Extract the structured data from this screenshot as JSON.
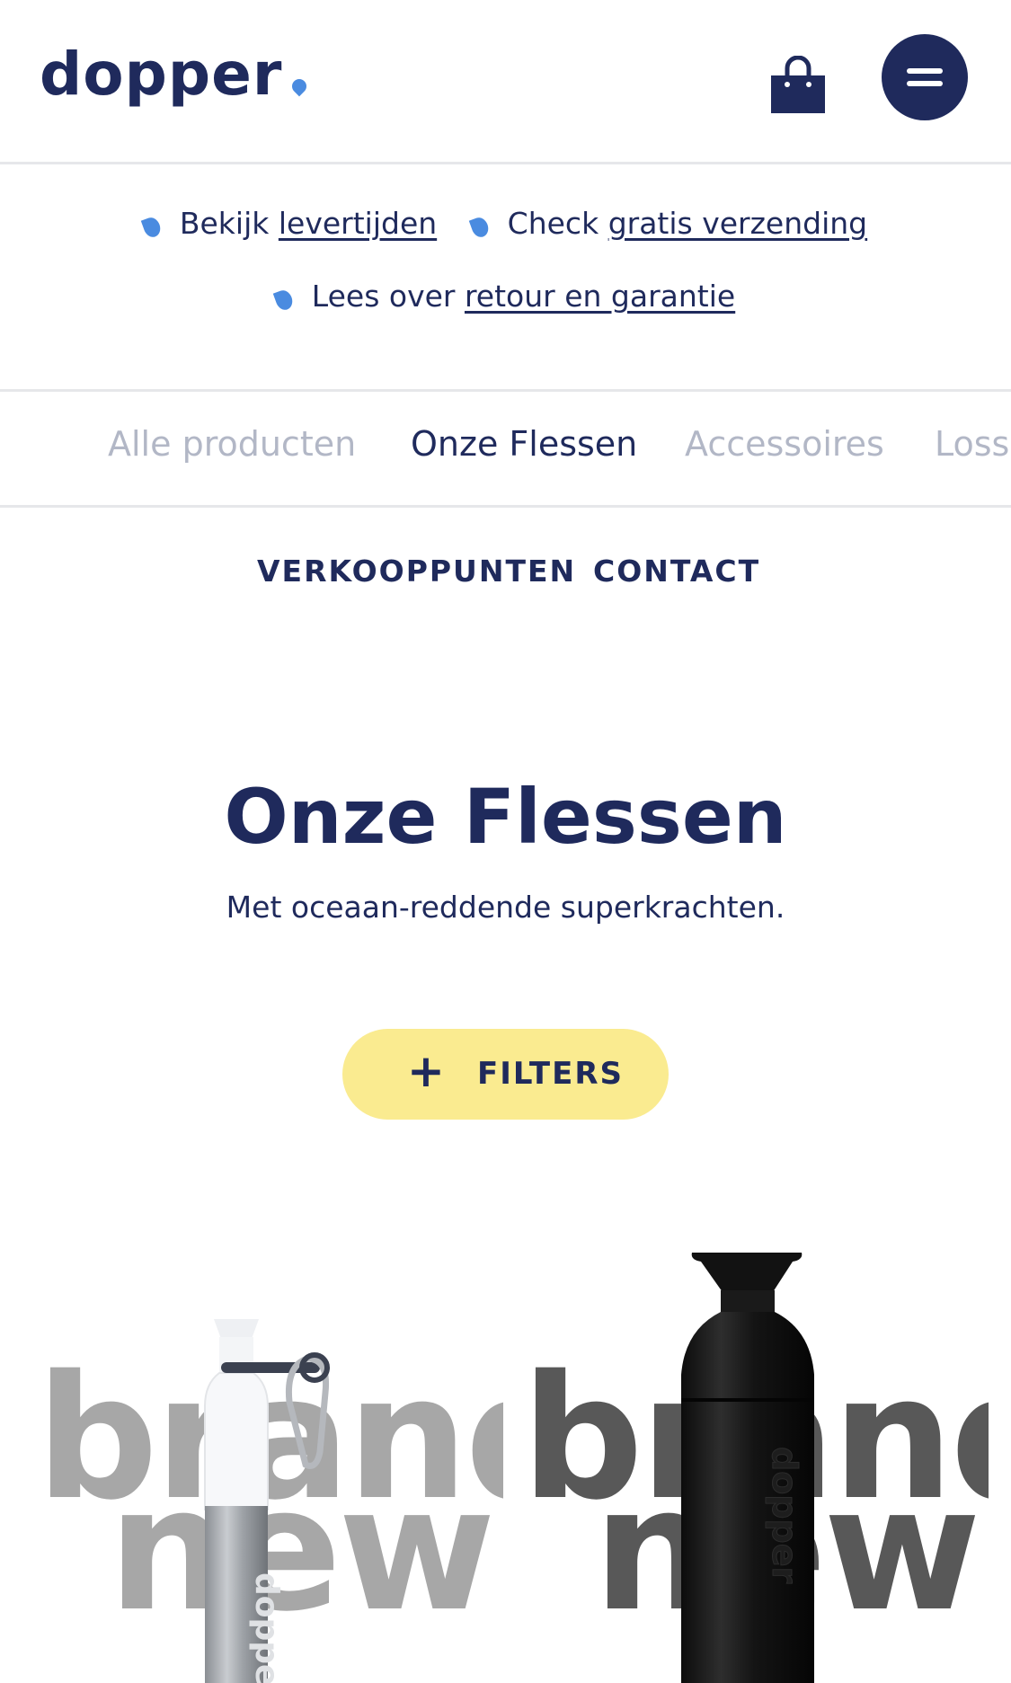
{
  "header": {
    "logo": "dopper",
    "bag_icon": "shopping-bag-icon",
    "menu_icon": "hamburger-menu-icon"
  },
  "info": {
    "rows": [
      [
        {
          "prefix": "Bekijk",
          "link": "levertijden"
        },
        {
          "prefix": "Check",
          "link": "gratis verzending"
        }
      ],
      [
        {
          "prefix": "Lees over",
          "link": "retour en garantie"
        }
      ]
    ]
  },
  "categories": [
    {
      "label": "Alle producten",
      "active": false
    },
    {
      "label": "Onze Flessen",
      "active": true
    },
    {
      "label": "Accessoires",
      "active": false
    },
    {
      "label": "Losse",
      "active": false
    }
  ],
  "subnav": [
    "VERKOOPPUNTEN",
    "CONTACT"
  ],
  "page": {
    "title": "Onze Flessen",
    "subtitle": "Met oceaan-reddende superkrachten."
  },
  "filters": {
    "icon": "+",
    "label": "FILTERS"
  },
  "products": [
    {
      "badge_line1": "brand",
      "badge_line2": "new",
      "bottle": "steel bottle with carabiner",
      "brand_text": "dopper"
    },
    {
      "badge_line1": "brand",
      "badge_line2": "new",
      "bottle": "black insulated bottle",
      "brand_text": "dopper"
    }
  ],
  "colors": {
    "navy": "#1f2a5c",
    "accent_blue": "#4a8be0",
    "filter_yellow": "#faeb90",
    "muted": "#b2b7c6"
  }
}
